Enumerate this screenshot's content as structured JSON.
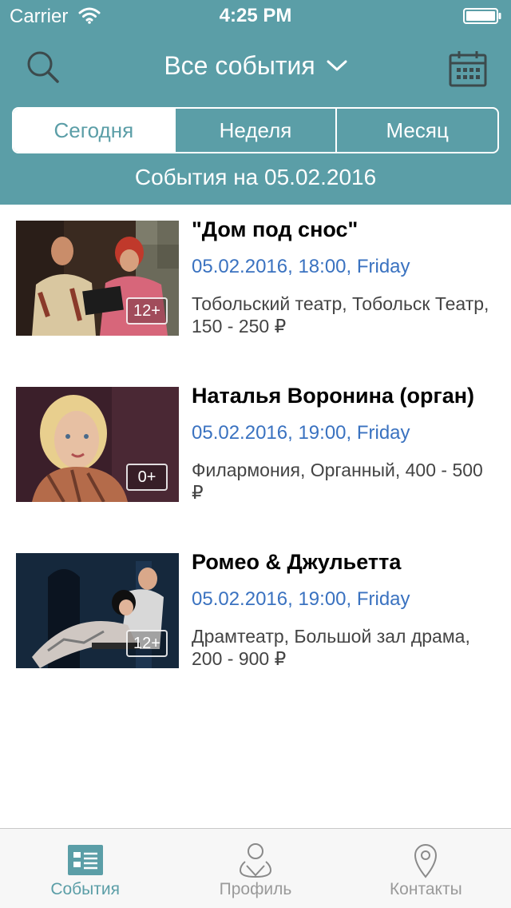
{
  "status_bar": {
    "carrier": "Carrier",
    "time": "4:25 PM"
  },
  "navbar": {
    "title": "Все события",
    "search_icon": "search-icon",
    "calendar_icon": "calendar-icon",
    "dropdown_icon": "chevron-down-icon"
  },
  "segments": {
    "items": [
      {
        "label": "Сегодня",
        "active": true
      },
      {
        "label": "Неделя",
        "active": false
      },
      {
        "label": "Месяц",
        "active": false
      }
    ]
  },
  "date_header": "События на 05.02.2016",
  "events": [
    {
      "title": "\"Дом под снос\"",
      "datetime": "05.02.2016, 18:00, Friday",
      "place": "Тобольский театр, Тобольск Театр, 150 - 250 ₽",
      "age": "12+"
    },
    {
      "title": "Наталья Воронина (орган)",
      "datetime": "05.02.2016, 19:00, Friday",
      "place": "Филармония, Органный, 400 - 500 ₽",
      "age": "0+"
    },
    {
      "title": "Ромео & Джульетта",
      "datetime": "05.02.2016, 19:00, Friday",
      "place": "Драмтеатр, Большой зал драма, 200 - 900 ₽",
      "age": "12+"
    }
  ],
  "tabbar": {
    "items": [
      {
        "label": "События",
        "icon": "events-list-icon",
        "active": true
      },
      {
        "label": "Профиль",
        "icon": "profile-icon",
        "active": false
      },
      {
        "label": "Контакты",
        "icon": "location-pin-icon",
        "active": false
      }
    ]
  },
  "colors": {
    "accent": "#5b9ea7",
    "date_link": "#3a72c0"
  }
}
